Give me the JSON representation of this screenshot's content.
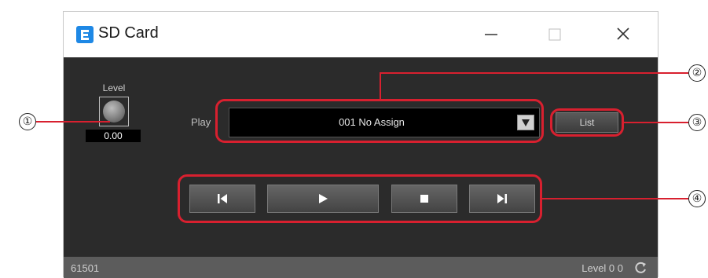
{
  "window": {
    "title": "SD Card",
    "icon": "app-e-icon",
    "controls": [
      "minimize-icon",
      "maximize-icon",
      "close-icon"
    ]
  },
  "level": {
    "label": "Level",
    "value": "0.00"
  },
  "play": {
    "label": "Play",
    "selected": "001 No Assign"
  },
  "list_button": {
    "label": "List"
  },
  "transport": {
    "buttons": [
      "previous-track-icon",
      "play-icon",
      "stop-icon",
      "next-track-icon"
    ]
  },
  "statusbar": {
    "left": "61501",
    "right": "Level 0 0",
    "icon": "refresh-icon"
  },
  "callouts": [
    "①",
    "②",
    "③",
    "④"
  ],
  "colors": {
    "panel_bg": "#2b2b2b",
    "status_bg": "#5c5c5c",
    "callout_red": "#d8202f",
    "app_icon_blue": "#1e88e5"
  }
}
